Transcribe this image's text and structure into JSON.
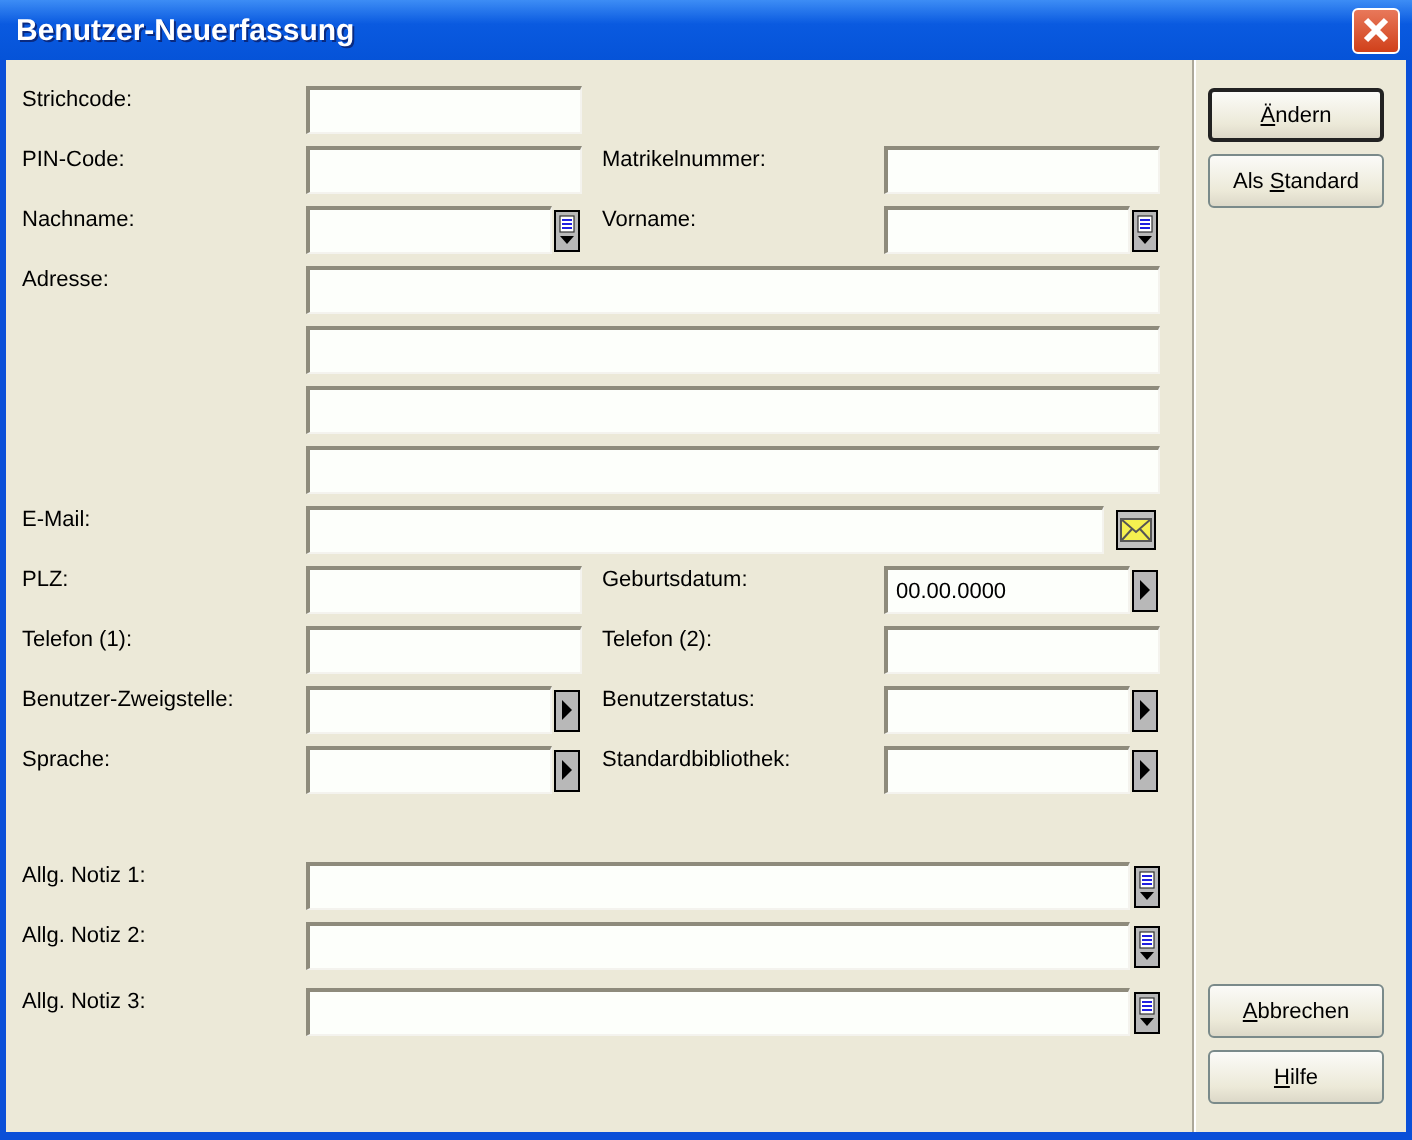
{
  "window": {
    "title": "Benutzer-Neuerfassung"
  },
  "rows": [
    {
      "kind": "pair",
      "fields": [
        {
          "label": "Strichcode:",
          "kind": "text"
        }
      ]
    },
    {
      "kind": "pair",
      "fields": [
        {
          "label": "PIN-Code:",
          "kind": "text"
        },
        {
          "label": "Matrikelnummer:",
          "kind": "text"
        }
      ]
    },
    {
      "kind": "pair",
      "fields": [
        {
          "label": "Nachname:",
          "kind": "list"
        },
        {
          "label": "Vorname:",
          "kind": "list"
        }
      ]
    },
    {
      "kind": "wide",
      "label": "Adresse:",
      "input": {
        "kind": "text"
      }
    },
    {
      "kind": "wide",
      "input": {
        "kind": "text"
      }
    },
    {
      "kind": "wide",
      "input": {
        "kind": "text"
      }
    },
    {
      "kind": "wide",
      "input": {
        "kind": "text"
      }
    },
    {
      "kind": "wide",
      "label": "E-Mail:",
      "input": {
        "kind": "email"
      }
    },
    {
      "kind": "pair",
      "fields": [
        {
          "label": "PLZ:",
          "kind": "text"
        },
        {
          "label": "Geburtsdatum:",
          "kind": "select",
          "value": "00.00.0000"
        }
      ]
    },
    {
      "kind": "pair",
      "fields": [
        {
          "label": "Telefon (1):",
          "kind": "text"
        },
        {
          "label": "Telefon (2):",
          "kind": "text"
        }
      ]
    },
    {
      "kind": "pair",
      "fields": [
        {
          "label": "Benutzer-Zweigstelle:",
          "kind": "select"
        },
        {
          "label": "Benutzerstatus:",
          "kind": "select"
        }
      ]
    },
    {
      "kind": "pair",
      "fields": [
        {
          "label": "Sprache:",
          "kind": "select"
        },
        {
          "label": "Standardbibliothek:",
          "kind": "select"
        }
      ]
    },
    {
      "kind": "spacer"
    },
    {
      "kind": "wide",
      "label": "Allg. Notiz 1:",
      "input": {
        "kind": "list"
      }
    },
    {
      "kind": "wide",
      "label": "Allg. Notiz 2:",
      "input": {
        "kind": "list"
      }
    },
    {
      "kind": "wide",
      "label": "Allg. Notiz 3:",
      "input": {
        "kind": "list"
      }
    }
  ],
  "top_buttons": [
    {
      "key": "Ä",
      "after": "ndern",
      "default": true
    },
    {
      "before": "Als ",
      "key": "S",
      "after": "tandard",
      "default": false
    }
  ],
  "bottom_buttons": [
    {
      "key": "A",
      "after": "bbrechen",
      "default": false
    },
    {
      "key": "H",
      "after": "ilfe",
      "default": false
    }
  ]
}
